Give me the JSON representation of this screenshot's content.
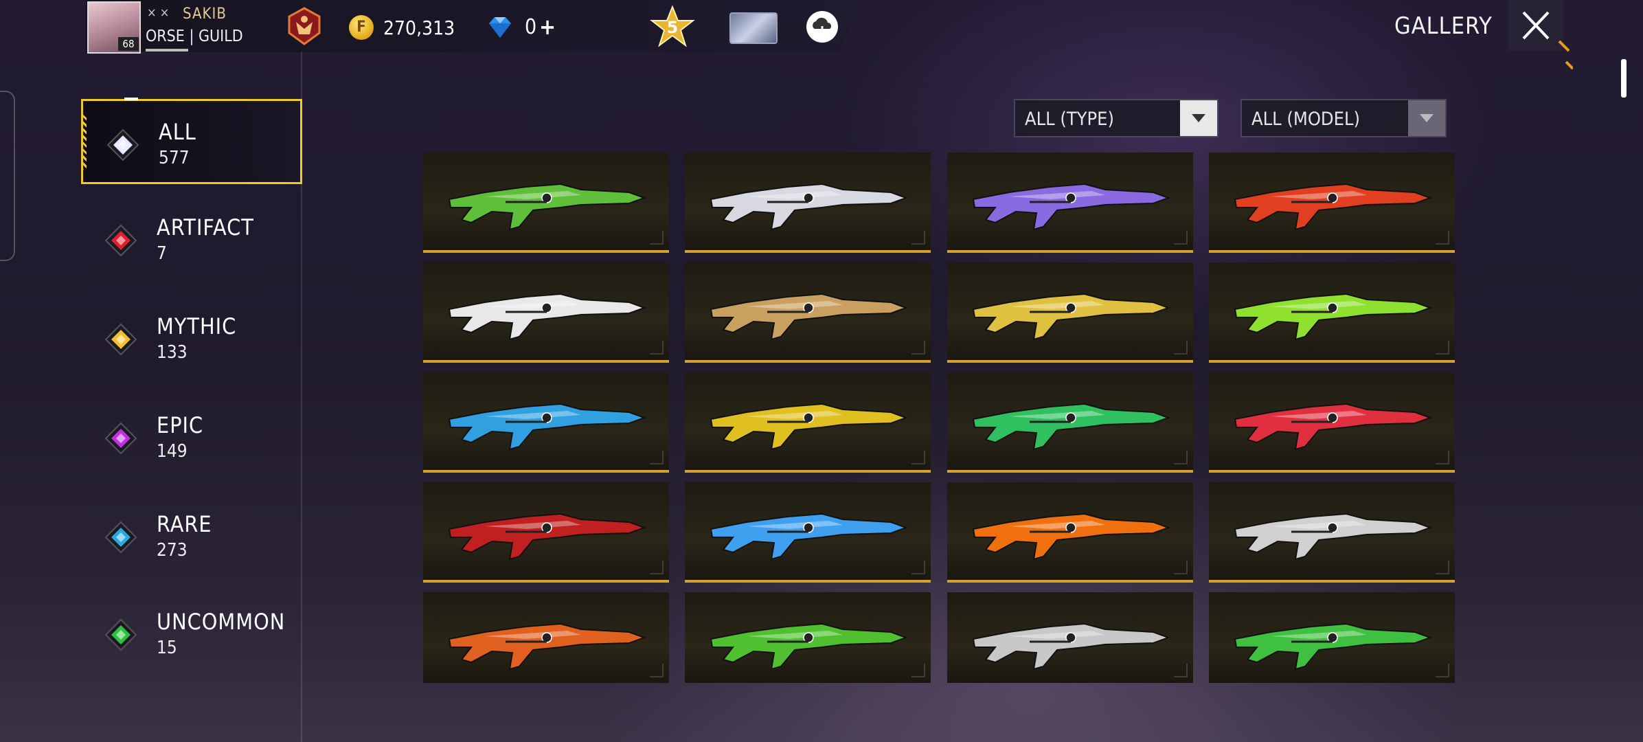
{
  "header": {
    "player_prefix": "× ×",
    "player_name": "SAKIB",
    "player_level": "68",
    "guild_text": "ORSE | GUILD",
    "coins": "270,313",
    "coin_symbol": "F",
    "diamonds": "0",
    "plus_symbol": "+",
    "rank_star_value": "5",
    "title": "GALLERY"
  },
  "categories": [
    {
      "name": "ALL",
      "count": "577",
      "color": "#e8e8ff",
      "selected": true
    },
    {
      "name": "ARTIFACT",
      "count": "7",
      "color": "#e02030"
    },
    {
      "name": "MYTHIC",
      "count": "133",
      "color": "#f0c030"
    },
    {
      "name": "EPIC",
      "count": "149",
      "color": "#c030e0"
    },
    {
      "name": "RARE",
      "count": "273",
      "color": "#2ea8e0"
    },
    {
      "name": "UNCOMMON",
      "count": "15",
      "color": "#30c040"
    }
  ],
  "filters": {
    "type_label": "ALL (TYPE)",
    "model_label": "ALL (MODEL)"
  },
  "items": [
    {
      "icon": "green-sniper-rifle-icon",
      "color": "#5fbf3a"
    },
    {
      "icon": "white-sniper-rifle-icon",
      "color": "#d8d8e0"
    },
    {
      "icon": "purple-sniper-rifle-icon",
      "color": "#8a6ae0"
    },
    {
      "icon": "red-sniper-rifle-icon",
      "color": "#e04020"
    },
    {
      "icon": "white-smg-icon",
      "color": "#e8e8e8"
    },
    {
      "icon": "tan-smg-icon",
      "color": "#c9a060"
    },
    {
      "icon": "gold-smg-icon",
      "color": "#e0c040"
    },
    {
      "icon": "lime-smg-icon",
      "color": "#90e030"
    },
    {
      "icon": "blue-assault-rifle-icon",
      "color": "#30a0e0"
    },
    {
      "icon": "yellow-assault-rifle-icon",
      "color": "#e0c020"
    },
    {
      "icon": "green-assault-rifle-icon",
      "color": "#30c060"
    },
    {
      "icon": "red-assault-rifle-icon",
      "color": "#e03040"
    },
    {
      "icon": "red-gold-shotgun-icon",
      "color": "#c02020"
    },
    {
      "icon": "ice-blue-rifle-icon",
      "color": "#40a0f0"
    },
    {
      "icon": "flame-rifle-icon",
      "color": "#f07010"
    },
    {
      "icon": "silver-rifle-icon",
      "color": "#d0d0d0"
    },
    {
      "icon": "flame-revolver-icon",
      "color": "#e06020"
    },
    {
      "icon": "green-shotgun-icon",
      "color": "#50c030"
    },
    {
      "icon": "silver-shotgun-icon",
      "color": "#c8c8c8"
    },
    {
      "icon": "bone-shotgun-icon",
      "color": "#40c040"
    }
  ]
}
